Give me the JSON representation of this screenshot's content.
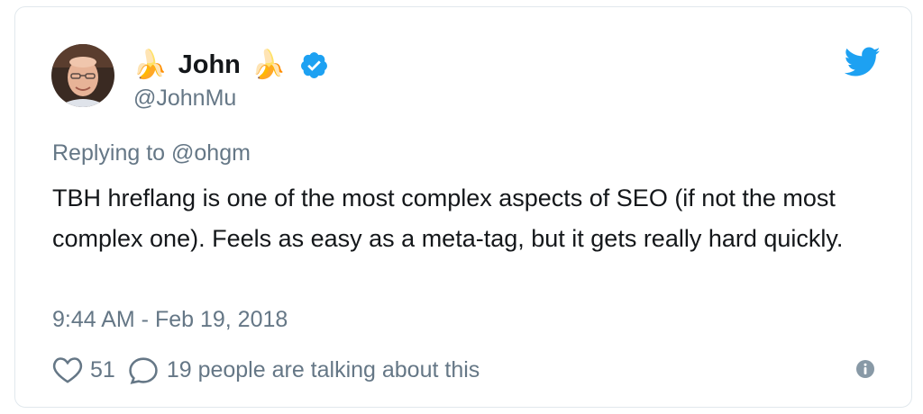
{
  "author": {
    "name_prefix_emoji": "🍌",
    "display_name": "John",
    "name_suffix_emoji": "🍌",
    "handle": "@JohnMu",
    "verified": true,
    "avatar_icon": "avatar-photo"
  },
  "tweet": {
    "replying_to": "Replying to @ohgm",
    "text": "TBH hreflang is one of the most complex aspects of SEO (if not the most complex one). Feels as easy as a meta-tag, but it gets really hard quickly.",
    "timestamp": "9:44 AM - Feb 19, 2018"
  },
  "actions": {
    "like_count": "51",
    "conversation_text": "19 people are talking about this"
  },
  "colors": {
    "twitter_blue": "#1da1f2",
    "muted_text": "#657786",
    "body_text": "#14171a",
    "border": "#e1e8ed"
  },
  "icons": {
    "brand": "twitter-bird-icon",
    "verified": "verified-badge-icon",
    "like": "heart-icon",
    "reply": "speech-bubble-icon",
    "info": "info-icon"
  }
}
